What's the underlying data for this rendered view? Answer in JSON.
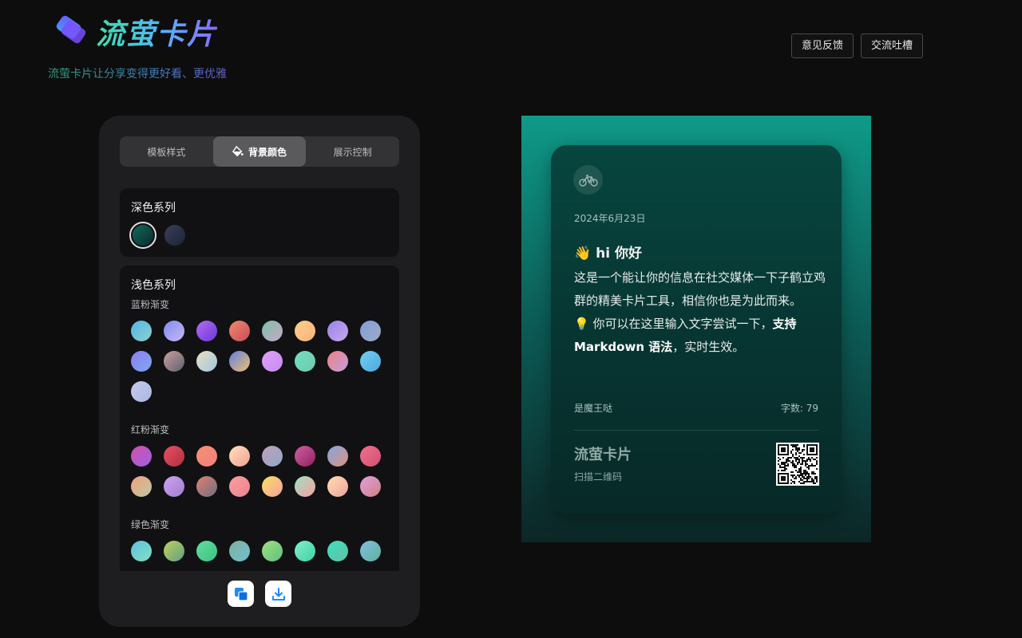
{
  "header": {
    "app_name": "流萤卡片",
    "tagline": "流萤卡片让分享变得更好看、更优雅",
    "feedback_label": "意见反馈",
    "chat_label": "交流吐槽"
  },
  "tabs": [
    {
      "label": "模板样式"
    },
    {
      "label": "背景颜色",
      "active": true
    },
    {
      "label": "展示控制"
    }
  ],
  "sections": {
    "dark": {
      "title": "深色系列",
      "swatches": [
        {
          "from": "#0e6b5e",
          "to": "#0a2a2a",
          "selected": true
        },
        {
          "from": "#3a3f5c",
          "to": "#1e2233"
        }
      ]
    },
    "light": {
      "title": "浅色系列",
      "groups": [
        {
          "title": "蓝粉渐变",
          "swatches": [
            {
              "from": "#4fb6e8",
              "to": "#8fd0c7"
            },
            {
              "from": "#7f8cf0",
              "to": "#c9b8f2"
            },
            {
              "from": "#b36cf5",
              "to": "#6b38d8"
            },
            {
              "from": "#f08a6a",
              "to": "#c94b5a"
            },
            {
              "from": "#7fc0a8",
              "to": "#c7a8c8"
            },
            {
              "from": "#ffd08a",
              "to": "#f7b27a"
            },
            {
              "from": "#9b82e8",
              "to": "#c6a8f0"
            },
            {
              "from": "#7f9fd8",
              "to": "#a0a8c8"
            },
            {
              "from": "#8d7cf0",
              "to": "#7fa8f0"
            },
            {
              "from": "#c8a0a0",
              "to": "#5f6070"
            },
            {
              "from": "#e8e0c0",
              "to": "#a0c8e0"
            },
            {
              "from": "#5f80e0",
              "to": "#f0c070"
            },
            {
              "from": "#e0a0f8",
              "to": "#c88cf0"
            },
            {
              "from": "#6ee0c0",
              "to": "#70c8b0"
            },
            {
              "from": "#f08080",
              "to": "#c0a0e0"
            },
            {
              "from": "#6fd0f0",
              "to": "#4fa8e0"
            },
            {
              "from": "#c8c8f0",
              "to": "#a8b8e0"
            }
          ]
        },
        {
          "title": "红粉渐变",
          "swatches": [
            {
              "from": "#d050b0",
              "to": "#a060e0"
            },
            {
              "from": "#e85060",
              "to": "#b03040"
            },
            {
              "from": "#f89070",
              "to": "#f08080"
            },
            {
              "from": "#ffe0c0",
              "to": "#f0a090"
            },
            {
              "from": "#c0a0c0",
              "to": "#8fa8c0"
            },
            {
              "from": "#d060a0",
              "to": "#902060"
            },
            {
              "from": "#7fa8e0",
              "to": "#e09080"
            },
            {
              "from": "#f07090",
              "to": "#d05070"
            },
            {
              "from": "#f0a080",
              "to": "#c0c8a0"
            },
            {
              "from": "#d0a0f0",
              "to": "#a080d0"
            },
            {
              "from": "#e08070",
              "to": "#707080"
            },
            {
              "from": "#f8a0a0",
              "to": "#f08090"
            },
            {
              "from": "#f8e060",
              "to": "#f8a0a0"
            },
            {
              "from": "#a0e0c0",
              "to": "#f8a0a0"
            },
            {
              "from": "#ffe0b0",
              "to": "#f0a0a0"
            },
            {
              "from": "#e0a0e0",
              "to": "#d08080"
            }
          ]
        },
        {
          "title": "绿色渐变",
          "swatches": [
            {
              "from": "#60c0e0",
              "to": "#80e0c0"
            },
            {
              "from": "#c0d060",
              "to": "#60a080"
            },
            {
              "from": "#60e0a0",
              "to": "#40c080"
            },
            {
              "from": "#80b0a0",
              "to": "#70c0d0"
            },
            {
              "from": "#a0e080",
              "to": "#60c080"
            },
            {
              "from": "#80f0d0",
              "to": "#40d0a0"
            },
            {
              "from": "#40e0c0",
              "to": "#60c0a0"
            },
            {
              "from": "#80c0e0",
              "to": "#60b0a0"
            }
          ]
        }
      ]
    }
  },
  "card": {
    "date": "2024年6月23日",
    "heading_emoji": "👋",
    "heading": "hi 你好",
    "body_line1": "这是一个能让你的信息在社交媒体一下子鹤立鸡群的精美卡片工具，相信你也是为此而来。",
    "body_line2_prefix": "💡 你可以在这里输入文字尝试一下，",
    "body_line2_bold": "支持 Markdown 语法",
    "body_line2_suffix": "，实时生效。",
    "author": "是魔王哒",
    "word_count": "字数: 79",
    "brand": "流萤卡片",
    "scan_label": "扫描二维码",
    "background": {
      "from": "#0f9a88",
      "to": "#0c2626"
    }
  }
}
